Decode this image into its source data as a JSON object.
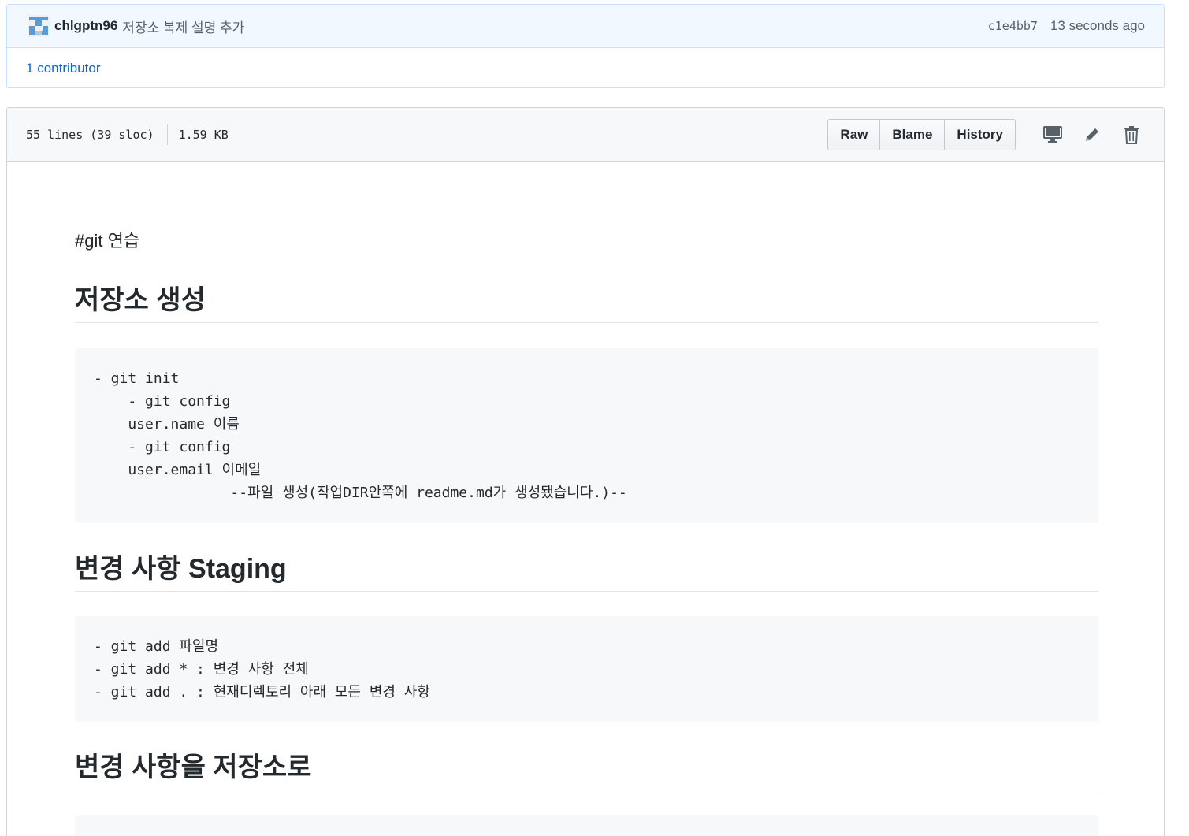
{
  "commit": {
    "author": "chlgptn96",
    "message": "저장소 복제 설명 추가",
    "sha": "c1e4bb7",
    "time": "13 seconds ago",
    "contributors_count": "1",
    "contributors_label": "contributor"
  },
  "file": {
    "lines": "55 lines (39 sloc)",
    "size": "1.59 KB",
    "buttons": {
      "raw": "Raw",
      "blame": "Blame",
      "history": "History"
    },
    "icons": [
      "desktop-icon",
      "pencil-icon",
      "trashcan-icon"
    ]
  },
  "markdown": {
    "intro": "#git 연습",
    "sections": [
      {
        "heading": "저장소 생성",
        "code": [
          "- git init",
          "    - git config",
          "    user.name 이름",
          "    - git config",
          "    user.email 이메일",
          "                --파일 생성(작업DIR안쪽에 readme.md가 생성됐습니다.)--"
        ]
      },
      {
        "heading": "변경 사항 Staging",
        "code": [
          "- git add 파일명",
          "- git add * : 변경 사항 전체",
          "- git add . : 현재디렉토리 아래 모든 변경 사항"
        ]
      },
      {
        "heading": "변경 사항을 저장소로",
        "code": []
      }
    ]
  },
  "colors": {
    "link": "#0366d6",
    "commit_bg": "#f1f8ff",
    "code_bg": "#f6f8fa"
  }
}
